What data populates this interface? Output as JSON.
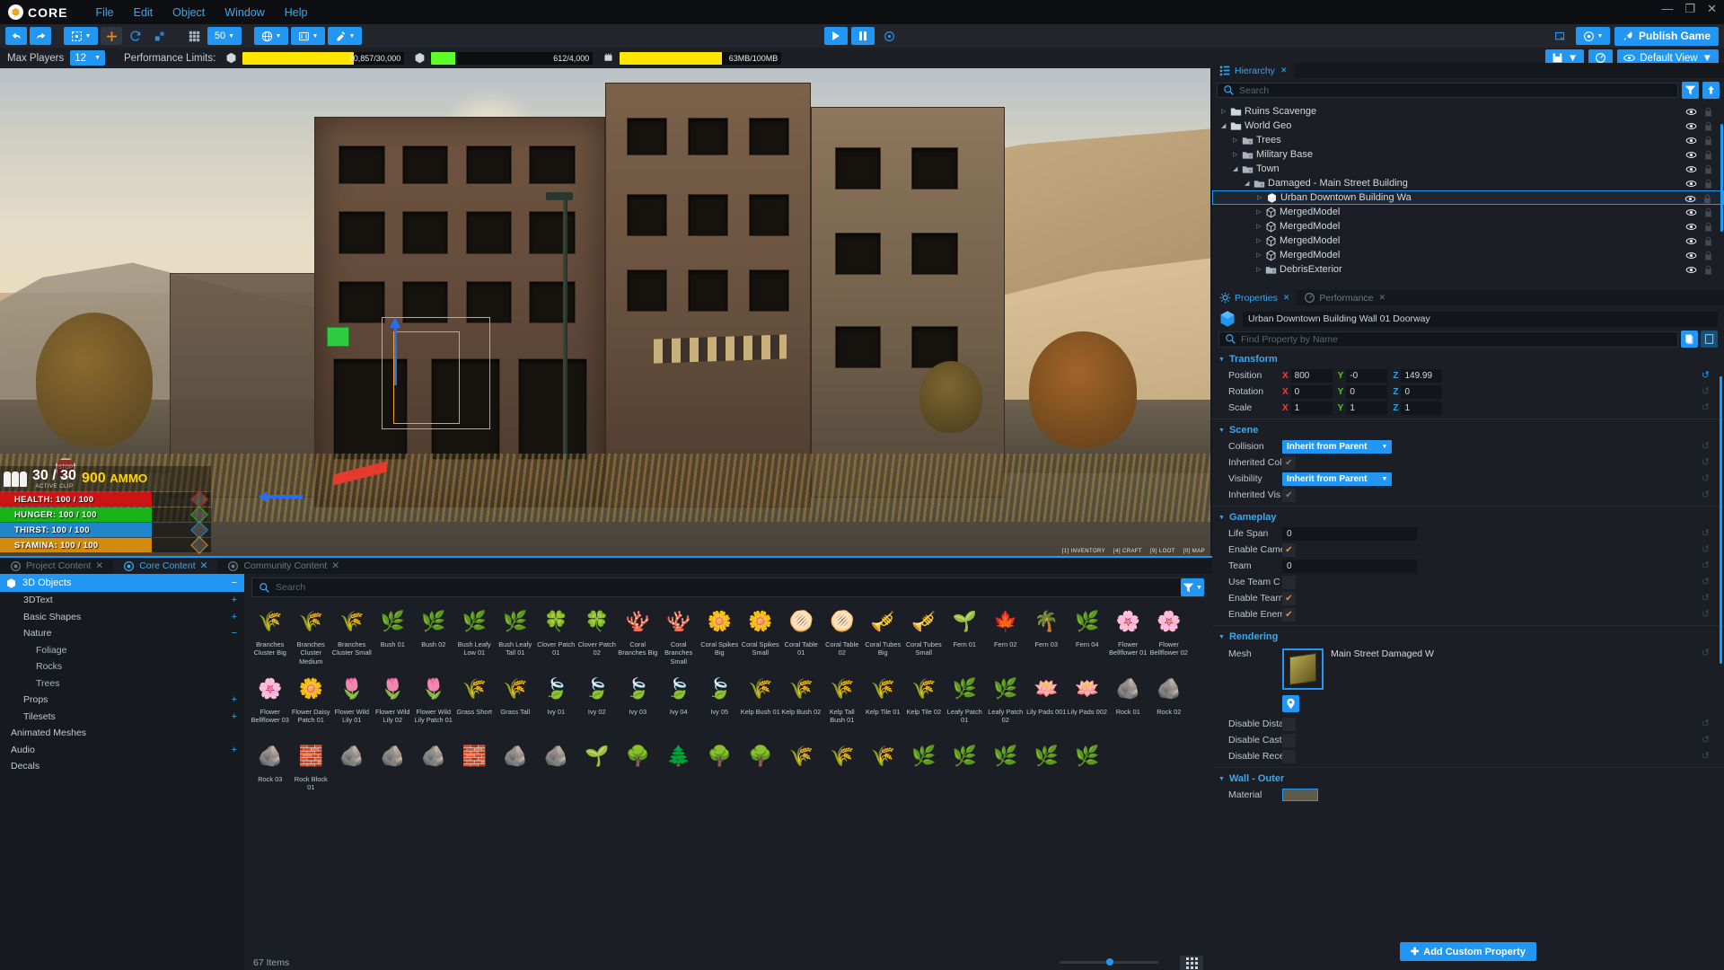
{
  "app": {
    "brand": "CORE",
    "menus": [
      "File",
      "Edit",
      "Object",
      "Window",
      "Help"
    ],
    "window_controls": {
      "minimize": "—",
      "maximize": "❐",
      "close": "✕"
    }
  },
  "toolbar": {
    "undo": "undo-arrow",
    "redo": "redo-arrow",
    "select_mode": "select-box",
    "translate": "move-tool",
    "rotate": "rotate-tool",
    "scale": "scale-tool",
    "grid": "grid-toggle",
    "grid_size": "50",
    "world_space": "globe",
    "snap": "snap-tool",
    "paint": "paint-tool",
    "play_label": "play",
    "pause_label": "pause",
    "multiplayer_preview": "multiplayer-icon",
    "screenshot": "screenshot-icon",
    "deploy": "deploy-icon",
    "publish_label": "Publish Game"
  },
  "perf": {
    "max_players_label": "Max Players",
    "max_players_value": "12",
    "limits_label": "Performance Limits:",
    "bars": [
      {
        "icon": "object-count-icon",
        "value": "20,857/30,000",
        "fill_pct": 69,
        "color": "#ffe500"
      },
      {
        "icon": "network-object-icon",
        "value": "612/4,000",
        "fill_pct": 15,
        "color": "#5dff2a"
      },
      {
        "icon": "memory-icon",
        "value": "63MB/100MB",
        "fill_pct": 63,
        "color": "#ffe500"
      }
    ],
    "save_icon": "save-icon",
    "perf_icon": "performance-icon",
    "view_label": "Default View"
  },
  "hierarchy": {
    "tab_label": "Hierarchy",
    "search_placeholder": "Search",
    "filter_icon": "filter-icon",
    "sort_icon": "sort-upload-icon",
    "items": [
      {
        "label": "Ruins Scavenge",
        "depth": 0,
        "arrow": "closed",
        "icon": "folder",
        "selected": false
      },
      {
        "label": "World Geo",
        "depth": 0,
        "arrow": "open",
        "icon": "folder",
        "selected": false
      },
      {
        "label": "Trees",
        "depth": 1,
        "arrow": "closed",
        "icon": "group",
        "selected": false
      },
      {
        "label": "Military Base",
        "depth": 1,
        "arrow": "closed",
        "icon": "group",
        "selected": false
      },
      {
        "label": "Town",
        "depth": 1,
        "arrow": "open",
        "icon": "group",
        "selected": false
      },
      {
        "label": "Damaged - Main Street Building",
        "depth": 2,
        "arrow": "open",
        "icon": "group",
        "selected": false
      },
      {
        "label": "Urban Downtown Building Wa",
        "depth": 3,
        "arrow": "closed",
        "icon": "mesh",
        "selected": true
      },
      {
        "label": "MergedModel",
        "depth": 3,
        "arrow": "closed",
        "icon": "merged",
        "selected": false
      },
      {
        "label": "MergedModel",
        "depth": 3,
        "arrow": "closed",
        "icon": "merged",
        "selected": false
      },
      {
        "label": "MergedModel",
        "depth": 3,
        "arrow": "closed",
        "icon": "merged",
        "selected": false
      },
      {
        "label": "MergedModel",
        "depth": 3,
        "arrow": "closed",
        "icon": "merged",
        "selected": false
      },
      {
        "label": "DebrisExterior",
        "depth": 3,
        "arrow": "closed",
        "icon": "group",
        "selected": false
      }
    ]
  },
  "properties": {
    "tabs": [
      {
        "label": "Properties",
        "active": true
      },
      {
        "label": "Performance",
        "active": false
      }
    ],
    "object_name": "Urban Downtown Building Wall 01 Doorway",
    "find_placeholder": "Find Property by Name",
    "copy_icon": "copy-icon",
    "paste_icon": "paste-icon",
    "sections": {
      "transform": {
        "title": "Transform",
        "rows": [
          {
            "label": "Position",
            "x": "800",
            "y": "-0",
            "z": "149.99",
            "reset_active": true
          },
          {
            "label": "Rotation",
            "x": "0",
            "y": "0",
            "z": "0",
            "reset_active": false
          },
          {
            "label": "Scale",
            "x": "1",
            "y": "1",
            "z": "1",
            "reset_active": false
          }
        ]
      },
      "scene": {
        "title": "Scene",
        "rows": [
          {
            "label": "Collision",
            "type": "dropdown",
            "value": "Inherit from Parent"
          },
          {
            "label": "Inherited Col",
            "type": "check-dim",
            "value": "✔"
          },
          {
            "label": "Visibility",
            "type": "dropdown",
            "value": "Inherit from Parent"
          },
          {
            "label": "Inherited Vis",
            "type": "check-dim",
            "value": "✔"
          }
        ]
      },
      "gameplay": {
        "title": "Gameplay",
        "rows": [
          {
            "label": "Life Span",
            "type": "text",
            "value": "0"
          },
          {
            "label": "Enable Came",
            "type": "check-on",
            "value": "✔"
          },
          {
            "label": "Team",
            "type": "text",
            "value": "0"
          },
          {
            "label": "Use Team C",
            "type": "check-off",
            "value": ""
          },
          {
            "label": "Enable Tearn",
            "type": "check-on",
            "value": "✔"
          },
          {
            "label": "Enable Enem",
            "type": "check-on",
            "value": "✔"
          }
        ]
      },
      "rendering": {
        "title": "Rendering",
        "mesh_label": "Mesh",
        "mesh_value": "Main Street Damaged W",
        "mesh_pin_icon": "locate-icon",
        "rows": [
          {
            "label": "Disable Dista",
            "type": "check-off",
            "value": ""
          },
          {
            "label": "Disable Cast",
            "type": "check-off",
            "value": ""
          },
          {
            "label": "Disable Rece",
            "type": "check-off",
            "value": ""
          }
        ]
      },
      "wall_outer": {
        "title": "Wall - Outer",
        "rows": [
          {
            "label": "Material",
            "type": "swatch",
            "value": ""
          }
        ]
      }
    },
    "add_custom_property": "Add Custom Property"
  },
  "content_browser": {
    "tabs": [
      {
        "label": "Project Content",
        "icon": "project-icon",
        "active": false
      },
      {
        "label": "Core Content",
        "icon": "core-icon",
        "active": true
      },
      {
        "label": "Community Content",
        "icon": "community-icon",
        "active": false
      }
    ],
    "categories": [
      {
        "label": "3D Objects",
        "level": 0,
        "state": "minus",
        "selected": true
      },
      {
        "label": "3DText",
        "level": 1,
        "state": "plus",
        "selected": false
      },
      {
        "label": "Basic Shapes",
        "level": 1,
        "state": "plus",
        "selected": false
      },
      {
        "label": "Nature",
        "level": 1,
        "state": "minus",
        "selected": false
      },
      {
        "label": "Foliage",
        "level": 2,
        "state": "",
        "selected": false
      },
      {
        "label": "Rocks",
        "level": 2,
        "state": "",
        "selected": false
      },
      {
        "label": "Trees",
        "level": 2,
        "state": "",
        "selected": false
      },
      {
        "label": "Props",
        "level": 1,
        "state": "plus",
        "selected": false
      },
      {
        "label": "Tilesets",
        "level": 1,
        "state": "plus",
        "selected": false
      },
      {
        "label": "Animated Meshes",
        "level": 0,
        "state": "",
        "selected": false
      },
      {
        "label": "Audio",
        "level": 0,
        "state": "plus",
        "selected": false
      },
      {
        "label": "Decals",
        "level": 0,
        "state": "",
        "selected": false
      }
    ],
    "search_placeholder": "Search",
    "filter_icon": "filter-icon",
    "item_count": "67 Items",
    "view_mode_icon": "grid-view-icon",
    "assets": [
      {
        "name": "Branches Cluster Big",
        "glyph": "🌾",
        "color": "#b49a5e"
      },
      {
        "name": "Branches Cluster Medium",
        "glyph": "🌾",
        "color": "#b49a5e"
      },
      {
        "name": "Branches Cluster Small",
        "glyph": "🌾",
        "color": "#b49a5e"
      },
      {
        "name": "Bush 01",
        "glyph": "🌿",
        "color": "#7dc43a"
      },
      {
        "name": "Bush 02",
        "glyph": "🌿",
        "color": "#7dc43a"
      },
      {
        "name": "Bush Leafy Low 01",
        "glyph": "🌿",
        "color": "#a5d13a"
      },
      {
        "name": "Bush Leafy Tall 01",
        "glyph": "🌿",
        "color": "#a5d13a"
      },
      {
        "name": "Clover Patch 01",
        "glyph": "🍀",
        "color": "#e2b725"
      },
      {
        "name": "Clover Patch 02",
        "glyph": "🍀",
        "color": "#e2b725"
      },
      {
        "name": "Coral Branches Big",
        "glyph": "🪸",
        "color": "#e2562a"
      },
      {
        "name": "Coral Branches Small",
        "glyph": "🪸",
        "color": "#e2562a"
      },
      {
        "name": "Coral Spikes Big",
        "glyph": "🌼",
        "color": "#f0b429"
      },
      {
        "name": "Coral Spikes Small",
        "glyph": "🌼",
        "color": "#f0b429"
      },
      {
        "name": "Coral Table 01",
        "glyph": "🫓",
        "color": "#5fc8bf"
      },
      {
        "name": "Coral Table 02",
        "glyph": "🫓",
        "color": "#5fc8bf"
      },
      {
        "name": "Coral Tubes Big",
        "glyph": "🎺",
        "color": "#2f6fe0"
      },
      {
        "name": "Coral Tubes Small",
        "glyph": "🎺",
        "color": "#2f6fe0"
      },
      {
        "name": "Fern 01",
        "glyph": "🌱",
        "color": "#6dbb34"
      },
      {
        "name": "Fern 02",
        "glyph": "🍁",
        "color": "#e06a1d"
      },
      {
        "name": "Fern 03",
        "glyph": "🌴",
        "color": "#5eb030"
      },
      {
        "name": "Fern 04",
        "glyph": "🌿",
        "color": "#4f9e2c"
      },
      {
        "name": "Flower Bellflower 01",
        "glyph": "🌸",
        "color": "#6f9fe0"
      },
      {
        "name": "Flower Bellflower 02",
        "glyph": "🌸",
        "color": "#6f9fe0"
      },
      {
        "name": "Flower Bellflower 03",
        "glyph": "🌸",
        "color": "#6f9fe0"
      },
      {
        "name": "Flower Daisy Patch 01",
        "glyph": "🌼",
        "color": "#e7d7a0"
      },
      {
        "name": "Flower Wild Lily 01",
        "glyph": "🌷",
        "color": "#d98bb5"
      },
      {
        "name": "Flower Wild Lily 02",
        "glyph": "🌷",
        "color": "#d98bb5"
      },
      {
        "name": "Flower Wild Lily Patch 01",
        "glyph": "🌷",
        "color": "#d98bb5"
      },
      {
        "name": "Grass Short",
        "glyph": "🌾",
        "color": "#9ab34a"
      },
      {
        "name": "Grass Tall",
        "glyph": "🌾",
        "color": "#9ab34a"
      },
      {
        "name": "Ivy 01",
        "glyph": "🍃",
        "color": "#8fc23a"
      },
      {
        "name": "Ivy 02",
        "glyph": "🍃",
        "color": "#8fc23a"
      },
      {
        "name": "Ivy 03",
        "glyph": "🍃",
        "color": "#8fc23a"
      },
      {
        "name": "Ivy 04",
        "glyph": "🍃",
        "color": "#8fc23a"
      },
      {
        "name": "Ivy 05",
        "glyph": "🍃",
        "color": "#8fc23a"
      },
      {
        "name": "Kelp Bush 01",
        "glyph": "🌾",
        "color": "#c9c33a"
      },
      {
        "name": "Kelp Bush 02",
        "glyph": "🌾",
        "color": "#c9c33a"
      },
      {
        "name": "Kelp Tall Bush 01",
        "glyph": "🌾",
        "color": "#c9c33a"
      },
      {
        "name": "Kelp Tile 01",
        "glyph": "🌾",
        "color": "#c9c33a"
      },
      {
        "name": "Kelp Tile 02",
        "glyph": "🌾",
        "color": "#c9c33a"
      },
      {
        "name": "Leafy Patch 01",
        "glyph": "🌿",
        "color": "#86c038"
      },
      {
        "name": "Leafy Patch 02",
        "glyph": "🌿",
        "color": "#86c038"
      },
      {
        "name": "Lily Pads 001",
        "glyph": "🪷",
        "color": "#74c142"
      },
      {
        "name": "Lily Pads 002",
        "glyph": "🪷",
        "color": "#74c142"
      },
      {
        "name": "Rock 01",
        "glyph": "🪨",
        "color": "#a8a59c"
      },
      {
        "name": "Rock 02",
        "glyph": "🪨",
        "color": "#a8a59c"
      },
      {
        "name": "Rock 03",
        "glyph": "🪨",
        "color": "#a8a59c"
      },
      {
        "name": "Rock Block 01",
        "glyph": "🧱",
        "color": "#a8a59c"
      },
      {
        "name": "",
        "glyph": "🪨",
        "color": "#8e8c85"
      },
      {
        "name": "",
        "glyph": "🪨",
        "color": "#8e8c85"
      },
      {
        "name": "",
        "glyph": "🪨",
        "color": "#8e8c85"
      },
      {
        "name": "",
        "glyph": "🧱",
        "color": "#8e8c85"
      },
      {
        "name": "",
        "glyph": "🪨",
        "color": "#9b9890"
      },
      {
        "name": "",
        "glyph": "🪨",
        "color": "#9b9890"
      },
      {
        "name": "",
        "glyph": "🌱",
        "color": "#66b233"
      },
      {
        "name": "",
        "glyph": "🌳",
        "color": "#6aa83a"
      },
      {
        "name": "",
        "glyph": "🌲",
        "color": "#5d9e33"
      },
      {
        "name": "",
        "glyph": "🌳",
        "color": "#6aa83a"
      },
      {
        "name": "",
        "glyph": "🌳",
        "color": "#7ab544"
      },
      {
        "name": "",
        "glyph": "🌾",
        "color": "#c9a93a"
      },
      {
        "name": "",
        "glyph": "🌾",
        "color": "#c9a93a"
      },
      {
        "name": "",
        "glyph": "🌾",
        "color": "#b8a23a"
      },
      {
        "name": "",
        "glyph": "🌿",
        "color": "#7cb93a"
      },
      {
        "name": "",
        "glyph": "🌿",
        "color": "#7cb93a"
      },
      {
        "name": "",
        "glyph": "🌿",
        "color": "#8ac243"
      },
      {
        "name": "",
        "glyph": "🌿",
        "color": "#8ac243"
      },
      {
        "name": "",
        "glyph": "🌿",
        "color": "#94c84c"
      }
    ]
  },
  "viewport": {
    "hud": {
      "clip": "30 / 30",
      "clip_caption": "ACTIVE CLIP",
      "ammo": "900",
      "ammo_caption": "AMMO",
      "stats": [
        {
          "label": "HEALTH: 100 / 100",
          "color": "#cc1414",
          "icon": "heart-icon"
        },
        {
          "label": "HUNGER: 100 / 100",
          "color": "#18b318",
          "icon": "drumstick-icon"
        },
        {
          "label": "THIRST: 100 / 100",
          "color": "#1f86c9",
          "icon": "canteen-icon"
        },
        {
          "label": "STAMINA: 100 / 100",
          "color": "#d18a10",
          "icon": "runner-icon"
        }
      ]
    },
    "floor_labels": [
      "[1] INVENTORY",
      "[4] CRAFT",
      "[9] LOOT",
      "[0] MAP"
    ]
  }
}
